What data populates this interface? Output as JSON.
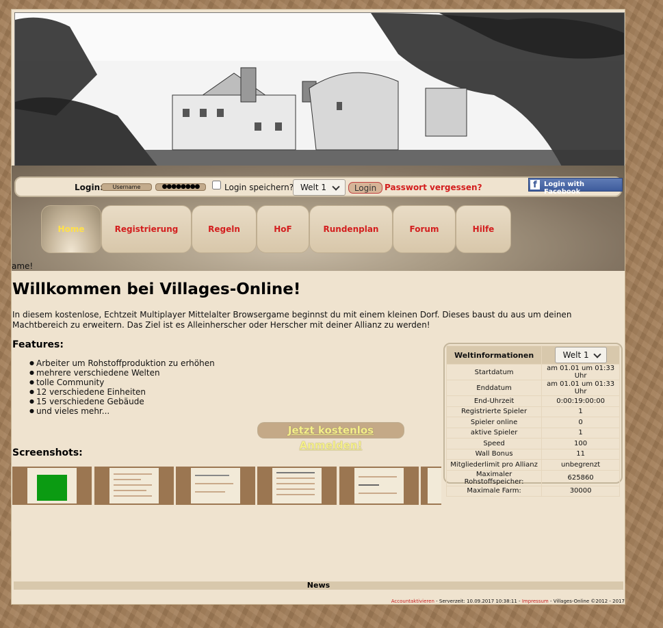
{
  "login": {
    "label": "Login:",
    "username_value": "Username",
    "password_mask": "●●●●●●●●",
    "remember_label": "Login speichern?",
    "world_select": "Welt 1",
    "button": "Login",
    "forgot": "Passwort vergessen?",
    "facebook": "Login with Facebook"
  },
  "nav": {
    "items": [
      {
        "label": "Home",
        "active": true
      },
      {
        "label": "Registrierung"
      },
      {
        "label": "Regeln"
      },
      {
        "label": "HoF"
      },
      {
        "label": "Rundenplan"
      },
      {
        "label": "Forum"
      },
      {
        "label": "Hilfe"
      }
    ],
    "overflow_text": "ame!"
  },
  "main": {
    "title": "Willkommen bei Villages-Online!",
    "intro": "In diesem kostenlose, Echtzeit Multiplayer Mittelalter Browsergame beginnst du mit einem kleinen Dorf. Dieses baust du aus um deinen Machtbereich zu erweitern. Das Ziel ist es Alleinherscher oder Herscher mit deiner Allianz zu werden!",
    "features_title": "Features:",
    "features": [
      "Arbeiter um Rohstoffproduktion zu erhöhen",
      "mehrere verschiedene Welten",
      "tolle Community",
      "12 verschiedene Einheiten",
      "15 verschiedene Gebäude",
      "und vieles mehr..."
    ],
    "signup": "Jetzt kostenlos Anmelden!",
    "screenshots_title": "Screenshots:"
  },
  "world_info": {
    "title": "Weltinformationen",
    "select": "Welt 1",
    "rows": [
      {
        "label": "Startdatum",
        "value": "am 01.01 um 01:33 Uhr"
      },
      {
        "label": "Enddatum",
        "value": "am 01.01 um 01:33 Uhr"
      },
      {
        "label": "End-Uhrzeit",
        "value": "0:00:19:00:00"
      },
      {
        "label": "Registrierte Spieler",
        "value": "1"
      },
      {
        "label": "Spieler online",
        "value": "0"
      },
      {
        "label": "aktive Spieler",
        "value": "1"
      },
      {
        "label": "Speed",
        "value": "100"
      },
      {
        "label": "Wall Bonus",
        "value": "11"
      },
      {
        "label": "Mitgliederlimit pro Allianz",
        "value": "unbegrenzt"
      },
      {
        "label": "Maximaler Rohstoffspeicher:",
        "value": "625860"
      },
      {
        "label": "Maximale Farm:",
        "value": "30000"
      }
    ]
  },
  "news": {
    "title": "News"
  },
  "footer": {
    "activate": "Accountaktivieren",
    "sep1": " - Serverzeit: 10.09.2017 10:38:11 - ",
    "impressum": "Impressum",
    "sep2": " - Villages-Online ©2012 - 2017"
  },
  "colors": {
    "link_red": "#d31e1e",
    "active_nav": "#ffe04a",
    "panel": "#efe3cf",
    "wood": "#a27d57"
  }
}
